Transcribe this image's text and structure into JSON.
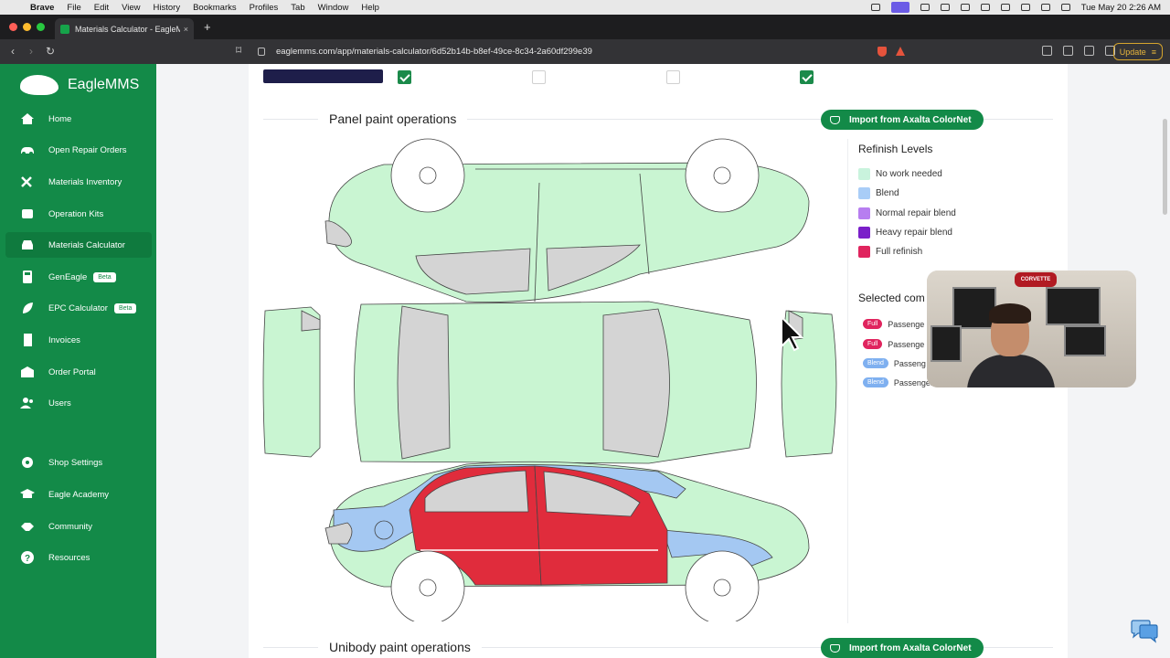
{
  "menubar": {
    "app": "Brave",
    "items": [
      "File",
      "Edit",
      "View",
      "History",
      "Bookmarks",
      "Profiles",
      "Tab",
      "Window",
      "Help"
    ],
    "clock": "Tue May 20  2:26 AM"
  },
  "browser": {
    "tab_title": "Materials Calculator - EagleMMS",
    "url": "eaglemms.com/app/materials-calculator/6d52b14b-b8ef-49ce-8c34-2a60df299e39",
    "update_label": "Update"
  },
  "sidebar": {
    "brand": "EagleMMS",
    "items": [
      {
        "label": "Home",
        "icon": "home-icon"
      },
      {
        "label": "Open Repair Orders",
        "icon": "car-icon"
      },
      {
        "label": "Materials Inventory",
        "icon": "tools-icon"
      },
      {
        "label": "Operation Kits",
        "icon": "kit-icon"
      },
      {
        "label": "Materials Calculator",
        "icon": "car-front-icon",
        "active": true
      },
      {
        "label": "GenEagle",
        "icon": "calculator-icon",
        "badge": "Beta"
      },
      {
        "label": "EPC Calculator",
        "icon": "leaf-icon",
        "badge": "Beta"
      },
      {
        "label": "Invoices",
        "icon": "invoice-icon"
      },
      {
        "label": "Order Portal",
        "icon": "store-icon"
      },
      {
        "label": "Users",
        "icon": "users-icon"
      },
      {
        "label": "Shop Settings",
        "icon": "gear-icon"
      },
      {
        "label": "Eagle Academy",
        "icon": "graduation-cap-icon"
      },
      {
        "label": "Community",
        "icon": "handshake-icon"
      },
      {
        "label": "Resources",
        "icon": "question-icon"
      }
    ]
  },
  "panel_section": {
    "title": "Panel paint operations",
    "import_label": "Import from Axalta ColorNet"
  },
  "unibody_section": {
    "title": "Unibody paint operations",
    "import_label": "Import from Axalta ColorNet"
  },
  "legend": {
    "title": "Refinish Levels",
    "items": [
      {
        "label": "No work needed",
        "color": "#c9f3dd"
      },
      {
        "label": "Blend",
        "color": "#a9cdf7"
      },
      {
        "label": "Normal repair blend",
        "color": "#b77ef0"
      },
      {
        "label": "Heavy repair blend",
        "color": "#7a1fc9"
      },
      {
        "label": "Full refinish",
        "color": "#e0245e"
      }
    ]
  },
  "selected": {
    "title": "Selected com",
    "rows": [
      {
        "badge": "Full",
        "label": "Passenge",
        "color": "#e0245e"
      },
      {
        "badge": "Full",
        "label": "Passenge",
        "color": "#e0245e"
      },
      {
        "badge": "Blend",
        "label": "Passeng",
        "color": "#7fb0f0"
      },
      {
        "badge": "Blend",
        "label": "Passenger q",
        "color": "#7fb0f0"
      }
    ]
  },
  "webcam": {
    "sign_text": "CORVETTE"
  },
  "colors": {
    "brand_green": "#138a48",
    "panel_none": "#c9f5d2",
    "panel_blend": "#a4c8f2",
    "panel_full": "#e02c3c",
    "glass": "#d4d4d4"
  }
}
